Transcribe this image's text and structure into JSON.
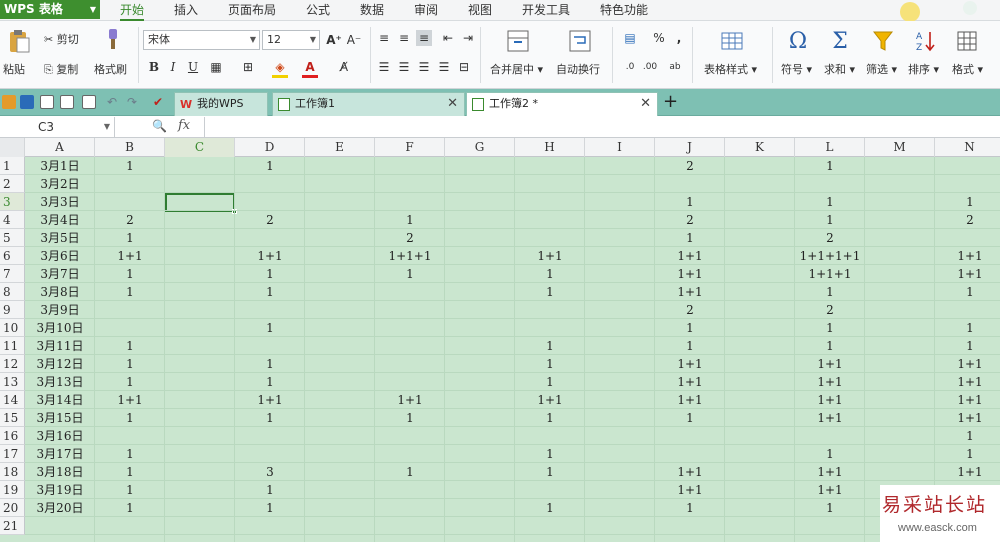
{
  "app": {
    "name": "WPS 表格"
  },
  "menu": [
    "开始",
    "插入",
    "页面布局",
    "公式",
    "数据",
    "审阅",
    "视图",
    "开发工具",
    "特色功能"
  ],
  "ribbon": {
    "paste": "粘贴",
    "cut": "剪切",
    "copy": "复制",
    "format_painter": "格式刷",
    "font_name": "宋体",
    "font_size": "12",
    "merge_center": "合并居中",
    "wrap_text": "自动换行",
    "table_style": "表格样式",
    "symbol": "符号",
    "sum": "求和",
    "filter": "筛选",
    "sort": "排序",
    "format": "格式",
    "bold": "B",
    "italic": "I",
    "underline": "U",
    "percent": "%"
  },
  "tabs": [
    {
      "label": "我的WPS"
    },
    {
      "label": "工作簿1"
    },
    {
      "label": "工作簿2 *"
    }
  ],
  "formula_bar": {
    "cell_ref": "C3",
    "fx": "fx",
    "value": ""
  },
  "grid": {
    "columns": [
      "A",
      "B",
      "C",
      "D",
      "E",
      "F",
      "G",
      "H",
      "I",
      "J",
      "K",
      "L",
      "M",
      "N"
    ],
    "selected_column": "C",
    "selected_row": 3,
    "rows": [
      {
        "n": "1",
        "A": "3月1日",
        "B": "1",
        "D": "1",
        "J": "2",
        "L": "1"
      },
      {
        "n": "2",
        "A": "3月2日"
      },
      {
        "n": "3",
        "A": "3月3日",
        "J": "1",
        "L": "1",
        "N": "1"
      },
      {
        "n": "4",
        "A": "3月4日",
        "B": "2",
        "D": "2",
        "F": "1",
        "J": "2",
        "L": "1",
        "N": "2"
      },
      {
        "n": "5",
        "A": "3月5日",
        "B": "1",
        "F": "2",
        "J": "1",
        "L": "2"
      },
      {
        "n": "6",
        "A": "3月6日",
        "B": "1+1",
        "D": "1+1",
        "F": "1+1+1",
        "H": "1+1",
        "J": "1+1",
        "L": "1+1+1+1",
        "N": "1+1"
      },
      {
        "n": "7",
        "A": "3月7日",
        "B": "1",
        "D": "1",
        "F": "1",
        "H": "1",
        "J": "1+1",
        "L": "1+1+1",
        "N": "1+1"
      },
      {
        "n": "8",
        "A": "3月8日",
        "B": "1",
        "D": "1",
        "H": "1",
        "J": "1+1",
        "L": "1",
        "N": "1"
      },
      {
        "n": "9",
        "A": "3月9日",
        "J": "2",
        "L": "2"
      },
      {
        "n": "10",
        "A": "3月10日",
        "D": "1",
        "J": "1",
        "L": "1",
        "N": "1"
      },
      {
        "n": "11",
        "A": "3月11日",
        "B": "1",
        "H": "1",
        "J": "1",
        "L": "1",
        "N": "1"
      },
      {
        "n": "12",
        "A": "3月12日",
        "B": "1",
        "D": "1",
        "H": "1",
        "J": "1+1",
        "L": "1+1",
        "N": "1+1"
      },
      {
        "n": "13",
        "A": "3月13日",
        "B": "1",
        "D": "1",
        "H": "1",
        "J": "1+1",
        "L": "1+1",
        "N": "1+1"
      },
      {
        "n": "14",
        "A": "3月14日",
        "B": "1+1",
        "D": "1+1",
        "F": "1+1",
        "H": "1+1",
        "J": "1+1",
        "L": "1+1",
        "N": "1+1"
      },
      {
        "n": "15",
        "A": "3月15日",
        "B": "1",
        "D": "1",
        "F": "1",
        "H": "1",
        "J": "1",
        "L": "1+1",
        "N": "1+1"
      },
      {
        "n": "16",
        "A": "3月16日",
        "N": "1"
      },
      {
        "n": "17",
        "A": "3月17日",
        "B": "1",
        "H": "1",
        "L": "1",
        "N": "1"
      },
      {
        "n": "18",
        "A": "3月18日",
        "B": "1",
        "D": "3",
        "F": "1",
        "H": "1",
        "J": "1+1",
        "L": "1+1",
        "N": "1+1"
      },
      {
        "n": "19",
        "A": "3月19日",
        "B": "1",
        "D": "1",
        "J": "1+1",
        "L": "1+1"
      },
      {
        "n": "20",
        "A": "3月20日",
        "B": "1",
        "D": "1",
        "H": "1",
        "J": "1",
        "L": "1"
      },
      {
        "n": "21"
      }
    ]
  },
  "watermark": {
    "text": "易采站长站",
    "url": "www.easck.com"
  },
  "colors": {
    "accent": "#3a8a2e",
    "tabbar": "#7ec0b3",
    "grid_bg": "#cae6cf"
  }
}
